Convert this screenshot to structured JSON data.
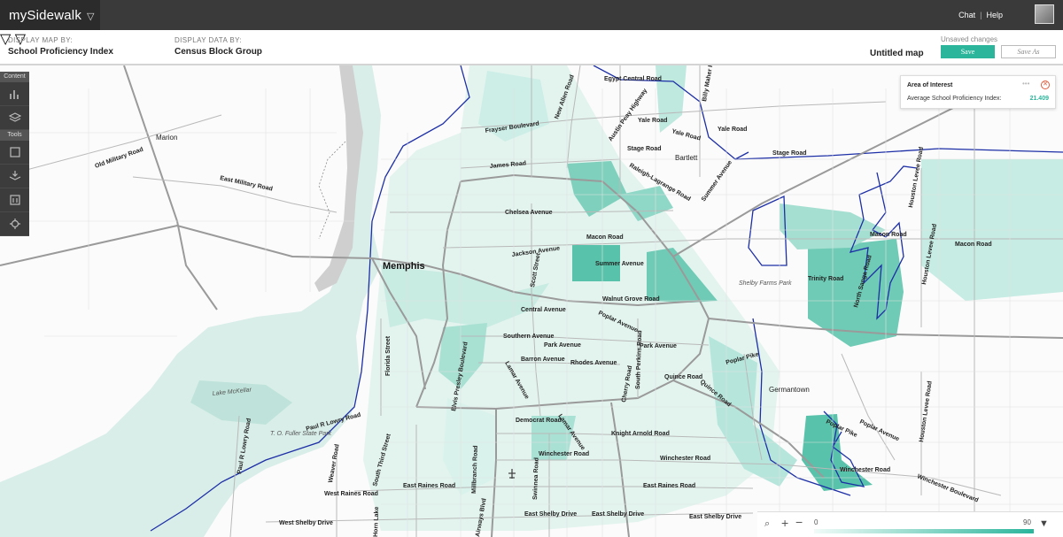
{
  "app": {
    "brand": "mySidewalk",
    "links": {
      "chat": "Chat",
      "sep": "|",
      "help": "Help"
    }
  },
  "controls": {
    "display_map_label": "DISPLAY MAP BY:",
    "display_map_value": "School Proficiency Index",
    "display_data_label": "DISPLAY DATA BY:",
    "display_data_value": "Census Block Group",
    "map_name": "Untitled map",
    "unsaved": "Unsaved changes",
    "save": "Save",
    "save_as": "Save As"
  },
  "sidebar": {
    "content_header": "Content",
    "tools_header": "Tools"
  },
  "aoi": {
    "title": "Area of Interest",
    "metric_label": "Average School Proficiency Index:",
    "metric_value": "21.409"
  },
  "legend": {
    "min": "0",
    "max": "90"
  },
  "map_labels": {
    "cities": {
      "memphis": "Memphis",
      "germantown": "Germantown",
      "bartlett": "Bartlett",
      "marion": "Marion"
    },
    "roads": {
      "old_military": "Old Military Road",
      "east_military": "East Military Road",
      "egypt_central": "Egypt Central Road",
      "frayser": "Frayser Boulevard",
      "new_allen": "New Allen Road",
      "austin_peay": "Austin Peay Highway",
      "yale1": "Yale Road",
      "yale2": "Yale Road",
      "yale3": "Yale Road",
      "billy_maher": "Billy Maher Road",
      "stage1": "Stage Road",
      "stage2": "Stage Road",
      "james": "James Road",
      "raleigh": "Raleigh-Lagrange Road",
      "summer_ave_ne": "Summer Avenue",
      "chelsea": "Chelsea Avenue",
      "jackson": "Jackson Avenue",
      "macon1": "Macon Road",
      "macon2": "Macon Road",
      "macon3": "Macon Road",
      "summer_avenue": "Summer Avenue",
      "scott": "Scott Street",
      "walnut_grove": "Walnut Grove Road",
      "central": "Central Avenue",
      "poplar1": "Poplar Avenue",
      "poplar2": "Poplar Avenue",
      "poplar_pike1": "Poplar Pike",
      "poplar_pike2": "Poplar Pike",
      "southern": "Southern Avenue",
      "park1": "Park Avenue",
      "park2": "Park Avenue",
      "barron": "Barron Avenue",
      "rhodes": "Rhodes Avenue",
      "lamar1": "Lamar Avenue",
      "lamar2": "Lamar Avenue",
      "florida": "Florida Street",
      "elvis": "Elvis Presley Boulevard",
      "cherry": "Cherry Road",
      "perkins": "South Perkins Road",
      "quince1": "Quince Road",
      "quince2": "Quince Road",
      "trinity": "Trinity Road",
      "north_sanga": "North Sanga Road",
      "houston_levee1": "Houston Levee Road",
      "houston_levee2": "Houston Levee Road",
      "houston_levee3": "Houston Levee Road",
      "democrat": "Democrat Road",
      "knight_arnold": "Knight Arnold Road",
      "winchester1": "Winchester Road",
      "winchester2": "Winchester Road",
      "winchester3": "Winchester Road",
      "winchester_blvd": "Winchester Boulevard",
      "paul_lowry1": "Paul R Lowry Road",
      "paul_lowry2": "Paul R Lowry Road",
      "weaver": "Weaver Road",
      "third": "South Third Street",
      "millbranch": "Millbranch Road",
      "swinnea": "Swinnea Road",
      "east_raines1": "East Raines Road",
      "east_raines2": "East Raines Road",
      "west_raines": "West Raines Road",
      "west_shelby": "West Shelby Drive",
      "east_shelby1": "East Shelby Drive",
      "east_shelby2": "East Shelby Drive",
      "east_shelby3": "East Shelby Drive",
      "horn_lake": "Horn Lake",
      "airways": "Airways Blvd"
    },
    "parks": {
      "lake": "Lake McKellar",
      "fuller": "T. O. Fuller State Park",
      "shelby_farms": "Shelby Farms Park"
    }
  }
}
